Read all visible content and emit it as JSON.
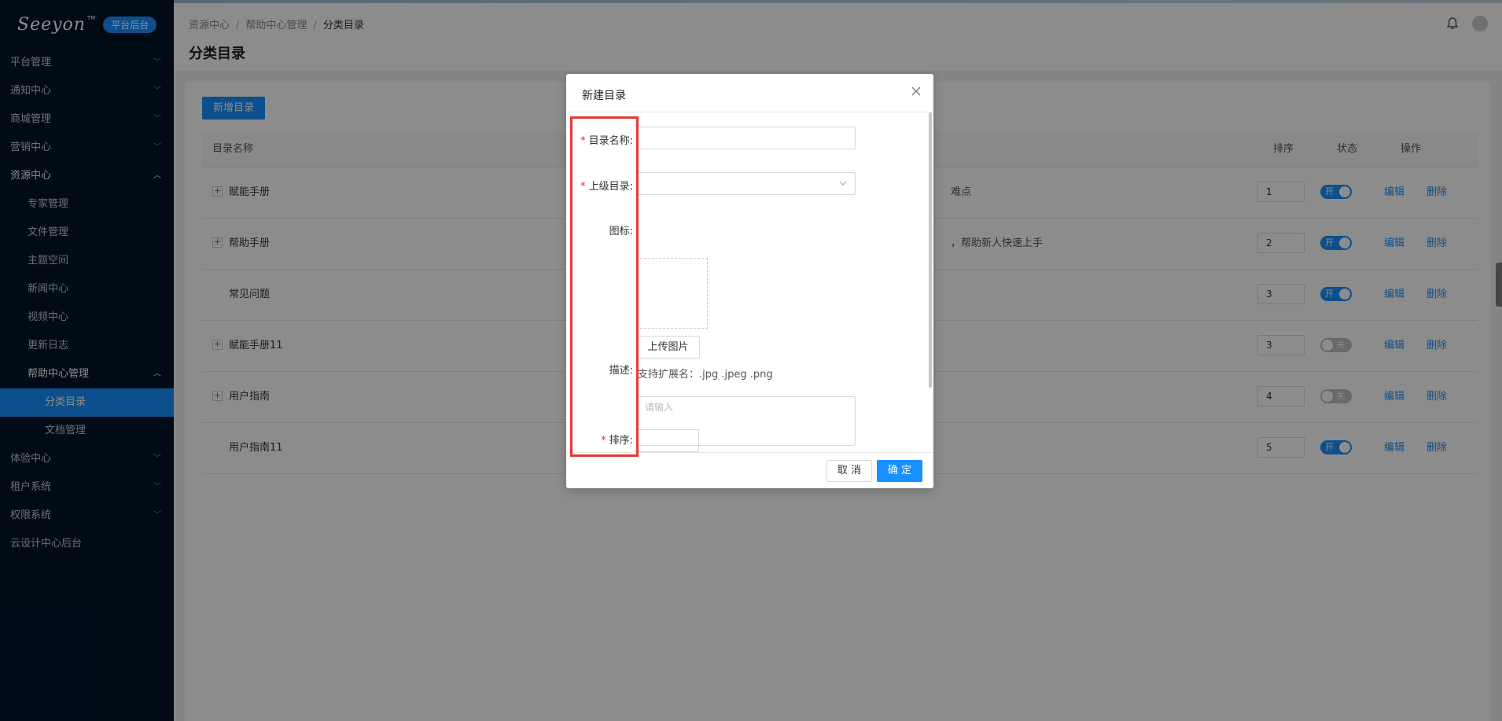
{
  "sidebar": {
    "logo": "Seeyon",
    "logo_tm": "TM",
    "badge": "平台后台",
    "items": [
      {
        "label": "平台管理"
      },
      {
        "label": "通知中心"
      },
      {
        "label": "商城管理"
      },
      {
        "label": "营销中心"
      },
      {
        "label": "资源中心"
      },
      {
        "label": "专家管理"
      },
      {
        "label": "文件管理"
      },
      {
        "label": "主题空间"
      },
      {
        "label": "新闻中心"
      },
      {
        "label": "视频中心"
      },
      {
        "label": "更新日志"
      },
      {
        "label": "帮助中心管理"
      },
      {
        "label": "分类目录"
      },
      {
        "label": "文档管理"
      },
      {
        "label": "体验中心"
      },
      {
        "label": "租户系统"
      },
      {
        "label": "权限系统"
      },
      {
        "label": "云设计中心后台"
      }
    ]
  },
  "header": {
    "breadcrumb": [
      "资源中心",
      "帮助中心管理",
      "分类目录"
    ],
    "breadcrumb_sep": "/",
    "title": "分类目录"
  },
  "content": {
    "add_button": "新增目录",
    "columns": {
      "name": "目录名称",
      "sort": "排序",
      "status": "状态",
      "action": "操作"
    },
    "rows": [
      {
        "expand": "+",
        "name": "赋能手册",
        "desc": "难点",
        "sort": "1",
        "status": "开",
        "edit": "编辑",
        "delete": "删除"
      },
      {
        "expand": "+",
        "name": "帮助手册",
        "desc": "，帮助新人快速上手",
        "sort": "2",
        "status": "开",
        "edit": "编辑",
        "delete": "删除"
      },
      {
        "expand": "",
        "name": "常见问题",
        "desc": "",
        "sort": "3",
        "status": "开",
        "edit": "编辑",
        "delete": "删除"
      },
      {
        "expand": "+",
        "name": "赋能手册11",
        "desc": "",
        "sort": "3",
        "status": "关",
        "edit": "编辑",
        "delete": "删除"
      },
      {
        "expand": "+",
        "name": "用户指南",
        "desc": "",
        "sort": "4",
        "status": "关",
        "edit": "编辑",
        "delete": "删除"
      },
      {
        "expand": "",
        "name": "用户指南11",
        "desc": "",
        "sort": "5",
        "status": "开",
        "edit": "编辑",
        "delete": "删除"
      }
    ]
  },
  "modal": {
    "title": "新建目录",
    "fields": {
      "name_label": "目录名称:",
      "parent_label": "上级目录:",
      "icon_label": "图标:",
      "upload_button": "上传图片",
      "upload_hint": "支持扩展名：.jpg .jpeg .png",
      "desc_label": "描述:",
      "desc_placeholder": "请输入",
      "sort_label": "排序:",
      "required_mark": "*"
    },
    "cancel": "取 消",
    "ok": "确 定"
  },
  "colors": {
    "accent": "#1890ff",
    "sidebar_bg": "#001529",
    "highlight": "#e53935"
  }
}
